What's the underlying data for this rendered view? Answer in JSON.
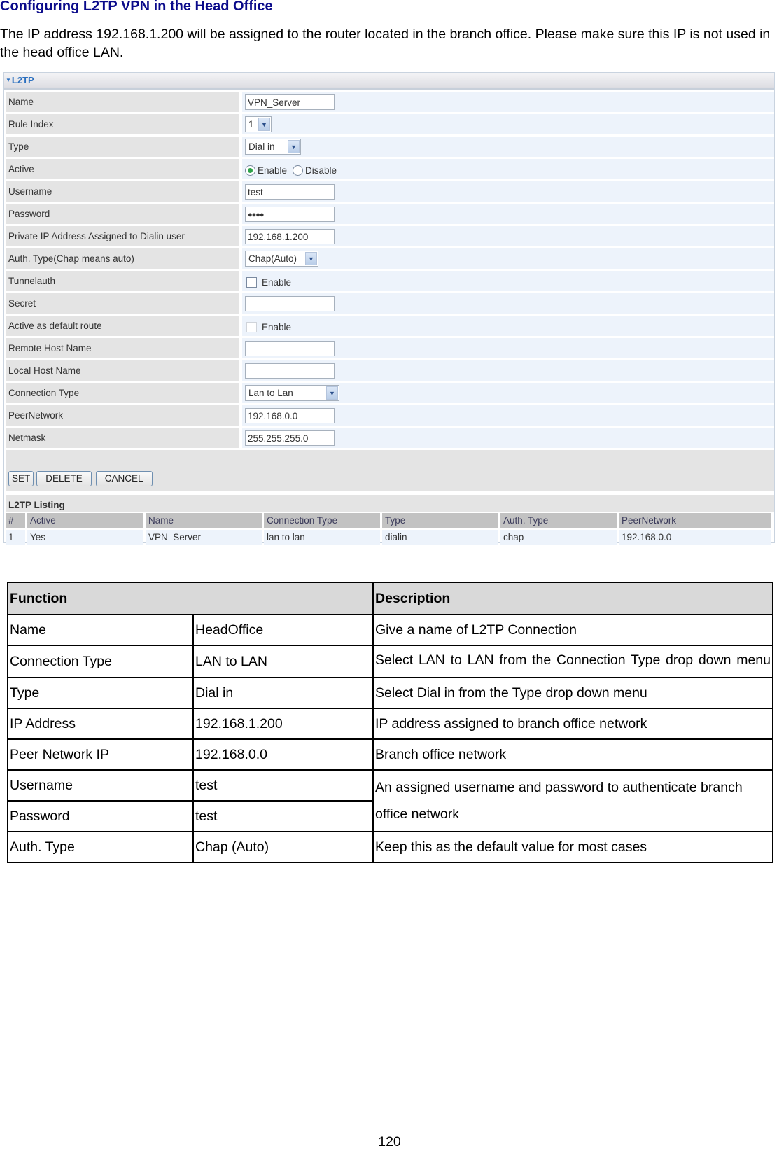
{
  "heading": "Configuring L2TP VPN in the Head Office",
  "intro": "The IP address 192.168.1.200 will be assigned to the router located in the branch office. Please make sure this IP is not used in the head office LAN.",
  "panel": {
    "title": "L2TP",
    "title_icon": "triangle-down-icon",
    "fields": {
      "name": {
        "label": "Name",
        "value": "VPN_Server"
      },
      "rule_index": {
        "label": "Rule Index",
        "value": "1"
      },
      "type": {
        "label": "Type",
        "value": "Dial in"
      },
      "active": {
        "label": "Active",
        "options": [
          "Enable",
          "Disable"
        ],
        "selected": "Enable"
      },
      "username": {
        "label": "Username",
        "value": "test"
      },
      "password": {
        "label": "Password",
        "value": "●●●●"
      },
      "private_ip": {
        "label": "Private IP Address Assigned to Dialin user",
        "value": "192.168.1.200"
      },
      "auth_type": {
        "label": "Auth. Type(Chap means auto)",
        "value": "Chap(Auto)"
      },
      "tunnelauth": {
        "label": "Tunnelauth",
        "checkbox_label": "Enable",
        "checked": false
      },
      "secret": {
        "label": "Secret",
        "value": ""
      },
      "default_route": {
        "label": "Active as default route",
        "checkbox_label": "Enable",
        "checked": false,
        "disabled": true
      },
      "remote_host": {
        "label": "Remote Host Name",
        "value": ""
      },
      "local_host": {
        "label": "Local Host Name",
        "value": ""
      },
      "connection_type": {
        "label": "Connection Type",
        "value": "Lan to Lan"
      },
      "peer_network": {
        "label": "PeerNetwork",
        "value": "192.168.0.0"
      },
      "netmask": {
        "label": "Netmask",
        "value": "255.255.255.0"
      }
    },
    "buttons": {
      "set": "SET",
      "delete": "DELETE",
      "cancel": "CANCEL"
    },
    "listing": {
      "title": "L2TP Listing",
      "columns": [
        "#",
        "Active",
        "Name",
        "Connection Type",
        "Type",
        "Auth. Type",
        "PeerNetwork"
      ],
      "rows": [
        [
          "1",
          "Yes",
          "VPN_Server",
          "lan to lan",
          "dialin",
          "chap",
          "192.168.0.0"
        ]
      ]
    }
  },
  "table": {
    "headers": {
      "function": "Function",
      "description": "Description"
    },
    "rows": [
      {
        "function": "Name",
        "value": "HeadOffice",
        "description": "Give a name of L2TP Connection"
      },
      {
        "function": "Connection Type",
        "value": "LAN to LAN",
        "description": "Select LAN to LAN from the Connection Type drop down menu"
      },
      {
        "function": "Type",
        "value": "Dial in",
        "description": "Select Dial in from the Type drop down menu"
      },
      {
        "function": "IP Address",
        "value": "192.168.1.200",
        "description": "IP address assigned to branch office network"
      },
      {
        "function": "Peer Network IP",
        "value": "192.168.0.0",
        "description": "Branch office network"
      },
      {
        "function": "Username",
        "value": "test",
        "description": "An assigned username and password to authenticate branch office network"
      },
      {
        "function": "Password",
        "value": "test"
      },
      {
        "function": "Auth. Type",
        "value": "Chap (Auto)",
        "description": "Keep this as the default value for most cases"
      }
    ]
  },
  "page_number": "120"
}
